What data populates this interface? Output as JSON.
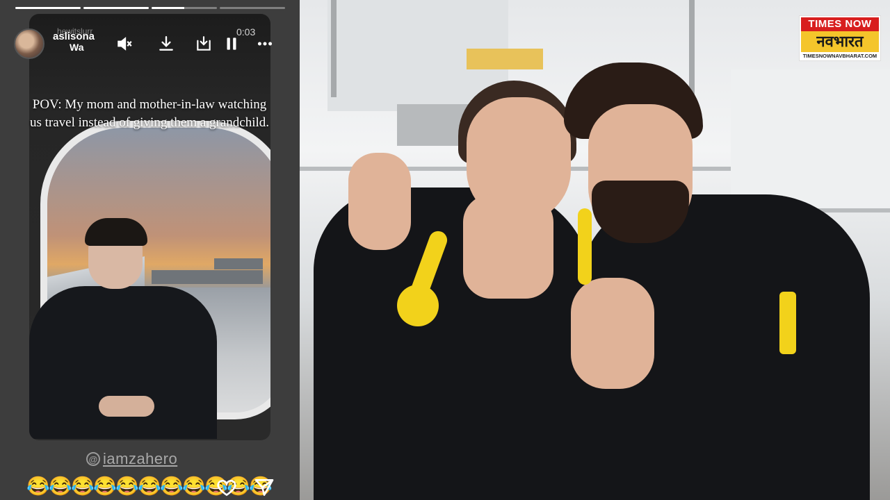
{
  "story": {
    "progress": [
      1,
      1,
      0.5,
      0
    ],
    "username_faded": "hewitslurr",
    "username": "aslisona",
    "subtitle": "Wa",
    "timestamp": "0:03",
    "pov_text": "POV: My mom and mother-in-law watching us travel instead of giving them a grandchild.",
    "mention": "iamzahero",
    "reactions": [
      "😂",
      "😂",
      "😂",
      "😂",
      "😂",
      "😂",
      "😂",
      "😂",
      "😂",
      "😂",
      "😂"
    ],
    "icons": {
      "mute": "speaker-muted-icon",
      "download": "download-icon",
      "save": "save-to-device-icon",
      "pause": "pause-icon",
      "more": "more-options-icon",
      "heart": "heart-icon",
      "send": "send-icon",
      "mention": "threads-icon"
    }
  },
  "logo": {
    "top": "TIMES NOW",
    "mid": "नवभारत",
    "bottom": "TIMESNOWNAVBHARAT.COM"
  },
  "colors": {
    "story_bg": "#3d3d3d",
    "logo_red": "#d81e1e",
    "logo_yellow": "#f4c52b",
    "gear_yellow": "#f2d21b"
  }
}
